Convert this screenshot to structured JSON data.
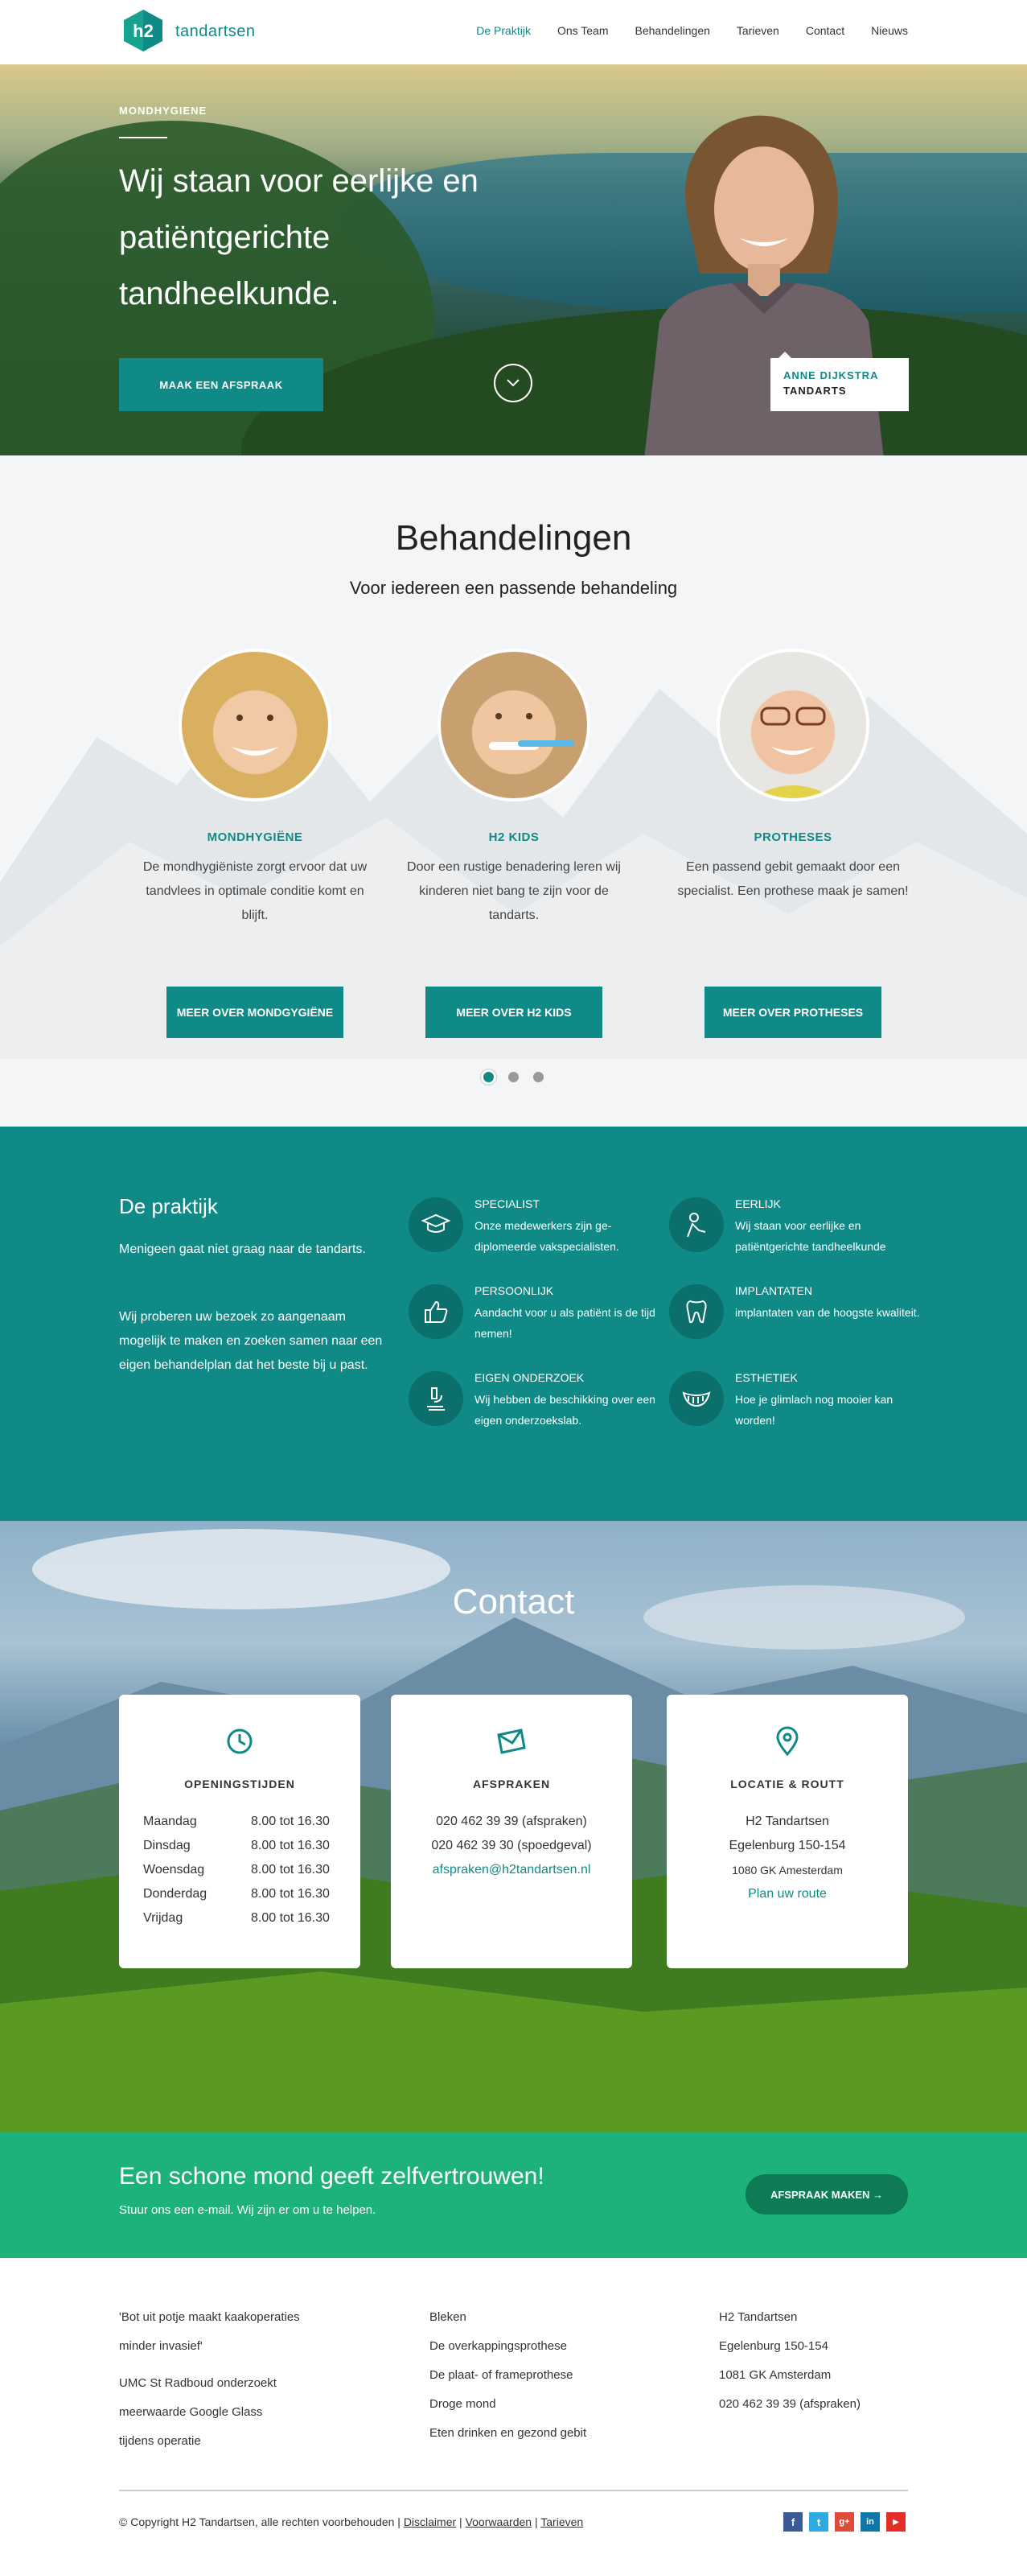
{
  "nav": {
    "logo_mark": "h2",
    "logo_text": "tandartsen",
    "items": [
      {
        "label": "De Praktijk",
        "active": true
      },
      {
        "label": "Ons Team"
      },
      {
        "label": "Behandelingen"
      },
      {
        "label": "Tarieven"
      },
      {
        "label": "Contact"
      },
      {
        "label": "Nieuws"
      }
    ]
  },
  "hero": {
    "label": "MONDHYGIENE",
    "title": "Wij staan voor eerlijke en patiëntgerichte tandheelkunde.",
    "button": "MAAK EEN AFSPRAAK",
    "person_name": "ANNE DIJKSTRA",
    "person_role": "TANDARTS"
  },
  "treatments": {
    "title": "Behandelingen",
    "subtitle": "Voor iedereen een passende behandeling",
    "items": [
      {
        "title": "MONDHYGIËNE",
        "text": "De mondhygiëniste zorgt ervoor dat uw tandvlees in optimale conditie komt en blijft.",
        "button": "MEER OVER MONDGYGIËNE"
      },
      {
        "title": "H2 KIDS",
        "text": "Door een rustige benadering leren wij kinderen niet bang te zijn voor de tandarts.",
        "button": "MEER OVER H2 KIDS"
      },
      {
        "title": "PROTHESES",
        "text": "Een passend gebit gemaakt door een specialist. Een prothese maak je samen!",
        "button": "MEER OVER PROTHESES"
      }
    ],
    "active_slide": 1,
    "slide_count": 3
  },
  "practice": {
    "title": "De praktijk",
    "p1": "Menigeen gaat niet graag naar de tandarts.",
    "p2": "Wij proberen uw bezoek zo aangenaam mogelijk te maken en zoeken samen naar een eigen behandelplan dat het beste bij u past.",
    "features": [
      {
        "title": "SPECIALIST",
        "text": "Onze medewerkers zijn ge-diplomeerde vakspecialisten.",
        "icon": "graduation-cap-icon"
      },
      {
        "title": "EERLIJK",
        "text": "Wij staan voor eerlijke en patiëntgerichte tandheelkunde",
        "icon": "person-icon"
      },
      {
        "title": "PERSOONLIJK",
        "text": "Aandacht voor u als patiënt is de tijd nemen!",
        "icon": "thumbs-up-icon"
      },
      {
        "title": "IMPLANTATEN",
        "text": "implantaten van de hoogste kwaliteit.",
        "icon": "tooth-icon"
      },
      {
        "title": "EIGEN ONDERZOEK",
        "text": "Wij hebben de beschikking over een eigen onderzoekslab.",
        "icon": "microscope-icon"
      },
      {
        "title": "ESTHETIEK",
        "text": "Hoe je glimlach nog mooier kan worden!",
        "icon": "smile-icon"
      }
    ]
  },
  "contact": {
    "title": "Contact",
    "hours": {
      "title": "OPENINGSTIJDEN",
      "rows": [
        {
          "day": "Maandag",
          "time": "8.00 tot 16.30"
        },
        {
          "day": "Dinsdag",
          "time": "8.00 tot 16.30"
        },
        {
          "day": "Woensdag",
          "time": "8.00 tot 16.30"
        },
        {
          "day": "Donderdag",
          "time": "8.00 tot 16.30"
        },
        {
          "day": "Vrijdag",
          "time": "8.00 tot 16.30"
        }
      ]
    },
    "appointments": {
      "title": "AFSPRAKEN",
      "phone1": "020 462 39 39  (afspraken)",
      "phone2": "020 462 39 30 (spoedgeval)",
      "email": "afspraken@h2tandartsen.nl"
    },
    "location": {
      "title": "LOCATIE & ROUTT",
      "name": "H2 Tandartsen",
      "street": "Egelenburg 150-154",
      "city": "1080 GK Amesterdam",
      "route": "Plan uw route"
    }
  },
  "cta": {
    "title": "Een schone mond geeft zelfvertrouwen!",
    "subtitle": "Stuur ons een e-mail. Wij zijn er om u te helpen.",
    "button": "AFSPRAAK MAKEN  →"
  },
  "footer": {
    "news": [
      "'Bot uit potje maakt kaakoperaties",
      "minder invasief'",
      "UMC St Radboud onderzoekt",
      "meerwaarde Google Glass",
      "tijdens operatie"
    ],
    "treatments": [
      "Bleken",
      "De overkappingsprothese",
      "De plaat- of frameprothese",
      "Droge mond",
      "Eten drinken en gezond gebit"
    ],
    "address": [
      "H2 Tandartsen",
      "Egelenburg 150-154",
      "1081 GK Amsterdam",
      "020 462 39 39 (afspraken)"
    ],
    "copyright": "© Copyright H2 Tandartsen, alle rechten voorbehouden",
    "links": [
      "Disclaimer",
      "Voorwaarden",
      "Tarieven"
    ],
    "social": [
      {
        "name": "facebook-icon",
        "glyph": "f",
        "color": "#3b5998"
      },
      {
        "name": "twitter-icon",
        "glyph": "t",
        "color": "#2fa9e1"
      },
      {
        "name": "googleplus-icon",
        "glyph": "g+",
        "color": "#dd4b39"
      },
      {
        "name": "linkedin-icon",
        "glyph": "in",
        "color": "#0e76a8"
      },
      {
        "name": "youtube-icon",
        "glyph": "▶",
        "color": "#e52d27"
      }
    ]
  },
  "colors": {
    "teal": "#0f8a86",
    "green": "#1cb27a"
  }
}
